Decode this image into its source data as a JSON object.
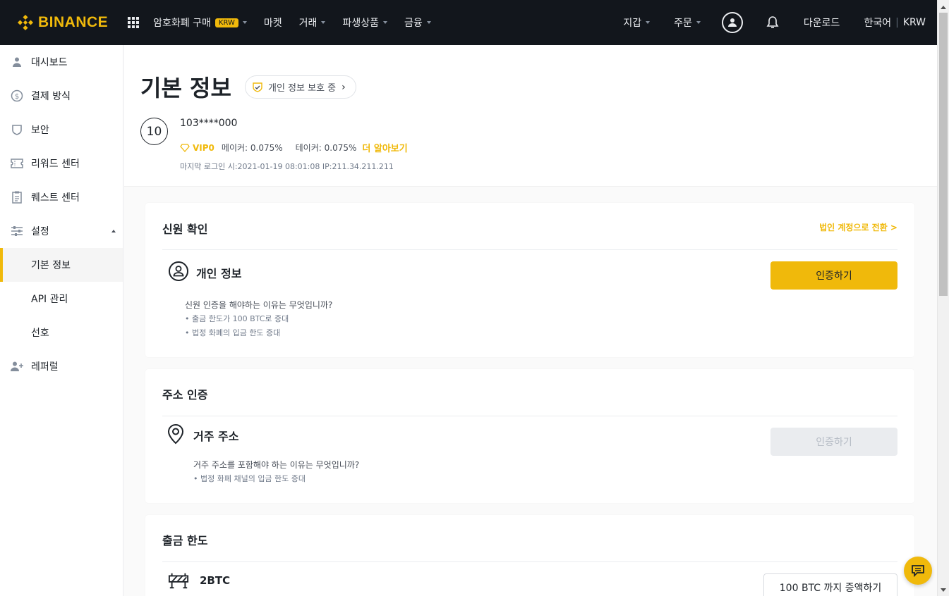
{
  "brand": {
    "name": "BINANCE",
    "color": "#f0b90b"
  },
  "nav": {
    "left": [
      {
        "label": "암호화폐 구매",
        "badge": "KRW",
        "has_caret": true
      },
      {
        "label": "마켓",
        "has_caret": false
      },
      {
        "label": "거래",
        "has_caret": true
      },
      {
        "label": "파생상품",
        "has_caret": true
      },
      {
        "label": "금융",
        "has_caret": true
      }
    ],
    "wallet": "지갑",
    "orders": "주문",
    "download": "다운로드",
    "language": "한국어",
    "currency": "KRW"
  },
  "sidebar": {
    "items": [
      {
        "label": "대시보드",
        "icon": "person-icon"
      },
      {
        "label": "결제 방식",
        "icon": "dollar-icon"
      },
      {
        "label": "보안",
        "icon": "shield-icon"
      },
      {
        "label": "리워드 센터",
        "icon": "ticket-icon"
      },
      {
        "label": "퀘스트 센터",
        "icon": "clipboard-icon"
      },
      {
        "label": "설정",
        "icon": "sliders-icon"
      },
      {
        "label": "기본 정보",
        "active": true
      },
      {
        "label": "API 관리"
      },
      {
        "label": "선호"
      },
      {
        "label": "레퍼럴",
        "icon": "add-user-icon"
      }
    ]
  },
  "header": {
    "title": "기본 정보",
    "privacy_badge": "개인 정보 보호 중",
    "level": "10",
    "user_id": "103****000",
    "vip": "VIP0",
    "maker": "메이커: 0.075%",
    "taker": "테이커: 0.075%",
    "learn_more": "더 알아보기",
    "last_login": "마지막 로그인 시:2021-01-19 08:01:08  IP:211.34.211.211"
  },
  "identity": {
    "title": "신원 확인",
    "corp_link": "법인 계정으로 전환  >",
    "row_label": "개인 정보",
    "button": "인증하기",
    "question": "신원 인증을 해야하는 이유는 무엇입니까?",
    "bullets": [
      "• 출금 한도가 100 BTC로 증대",
      "• 법정 화폐의 입금 한도 증대"
    ]
  },
  "address": {
    "title": "주소 인증",
    "row_label": "거주 주소",
    "button": "인증하기",
    "question": "거주 주소를 포함해야 하는 이유는 무엇입니까?",
    "bullets": [
      "• 법정 화폐 채널의 입금 한도 증대"
    ]
  },
  "withdrawal": {
    "title": "출금 한도",
    "row_label": "2BTC",
    "button": "100 BTC 까지 증액하기"
  },
  "colors": {
    "accent": "#f0b90b",
    "nav_bg": "#12161c"
  }
}
